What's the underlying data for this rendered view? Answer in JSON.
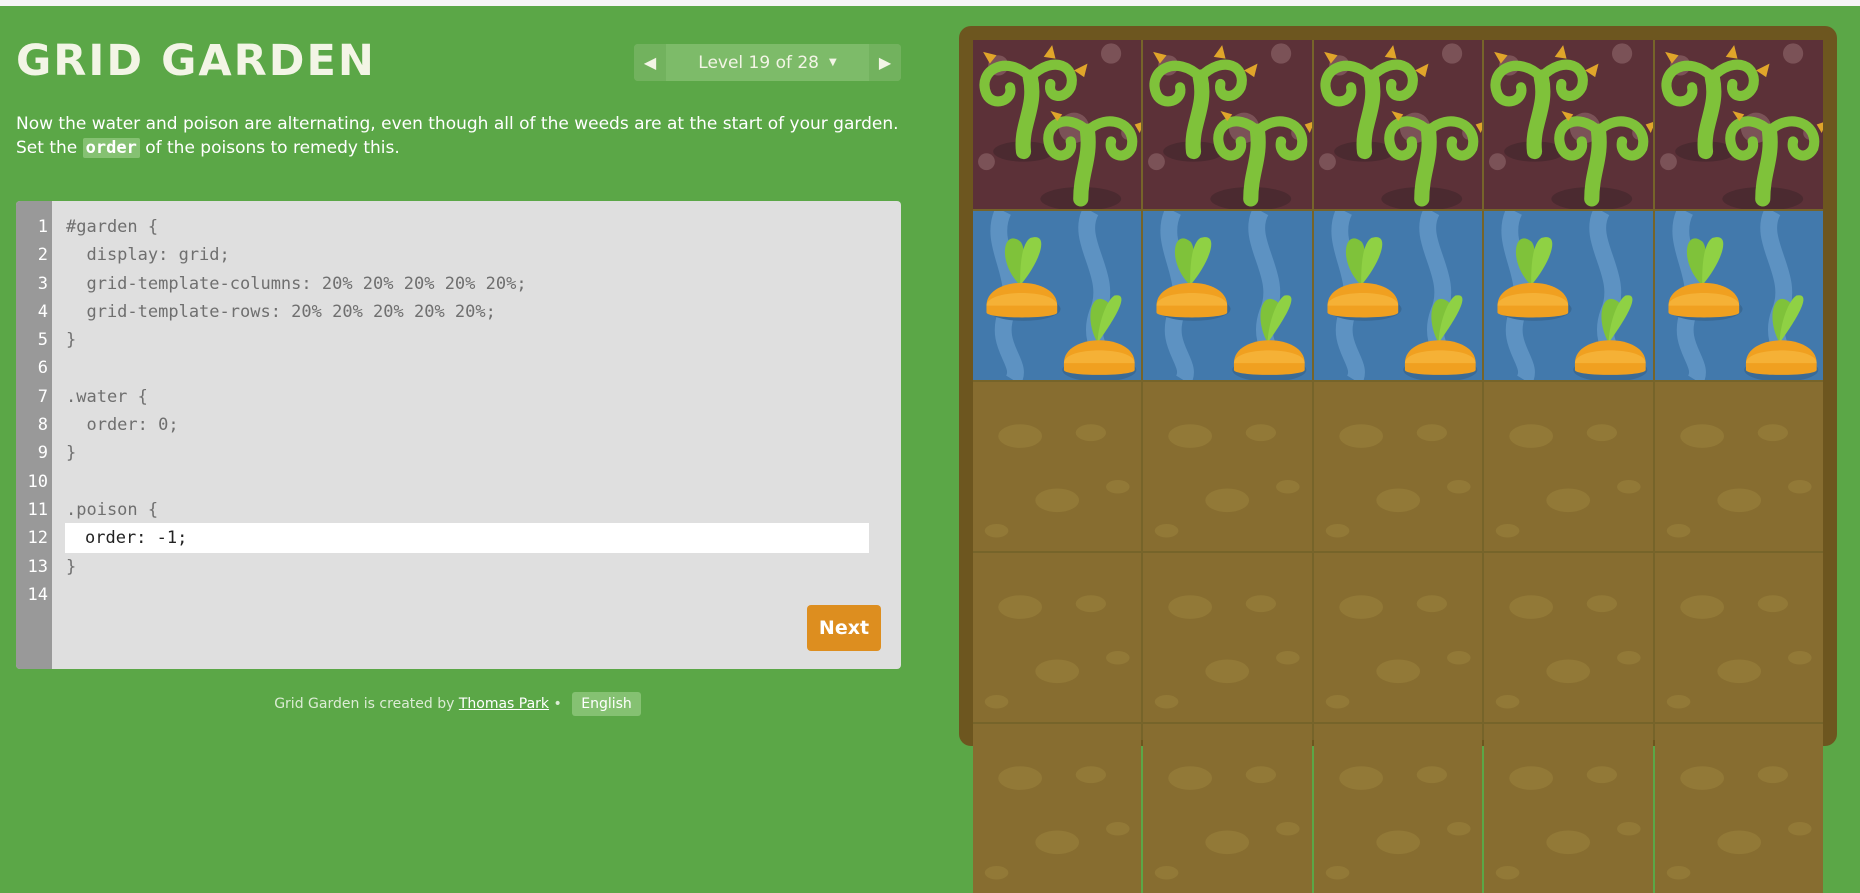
{
  "app": {
    "title": "GRID GARDEN"
  },
  "level_nav": {
    "label": "Level 19 of 28",
    "prev_icon": "triangle-left",
    "next_icon": "triangle-right",
    "dropdown_icon": "caret-down"
  },
  "instructions": {
    "text_before": "Now the water and poison are alternating, even though all of the weeds are at the start of your garden. Set the ",
    "code_word": "order",
    "text_after": " of the poisons to remedy this."
  },
  "editor": {
    "line_numbers": [
      "1",
      "2",
      "3",
      "4",
      "5",
      "6",
      "7",
      "8",
      "9",
      "10",
      "11",
      "12",
      "13",
      "14"
    ],
    "lines": [
      "#garden {",
      "  display: grid;",
      "  grid-template-columns: 20% 20% 20% 20% 20%;",
      "  grid-template-rows: 20% 20% 20% 20% 20%;",
      "}",
      "",
      ".water {",
      "  order: 0;",
      "}",
      "",
      ".poison {",
      "",
      "}",
      ""
    ],
    "input_value": "order: -1;",
    "next_label": "Next"
  },
  "footer": {
    "prefix": "Grid Garden is created by ",
    "author": "Thomas Park",
    "separator": " • ",
    "language": "English"
  },
  "garden": {
    "cells": [
      "poison",
      "poison",
      "poison",
      "poison",
      "poison",
      "water",
      "water",
      "water",
      "water",
      "water",
      "soil",
      "soil",
      "soil",
      "soil",
      "soil",
      "soil",
      "soil",
      "soil",
      "soil",
      "soil",
      "soil",
      "soil",
      "soil",
      "soil",
      "soil"
    ]
  },
  "colors": {
    "background": "#5ba747",
    "garden_frame": "#6d561f",
    "soil": "#876d30",
    "poison": "#5c3138",
    "water": "#4279ac",
    "next_button": "#dd8e1f",
    "editor_bg": "#dfdfdf",
    "gutter": "#999999"
  }
}
